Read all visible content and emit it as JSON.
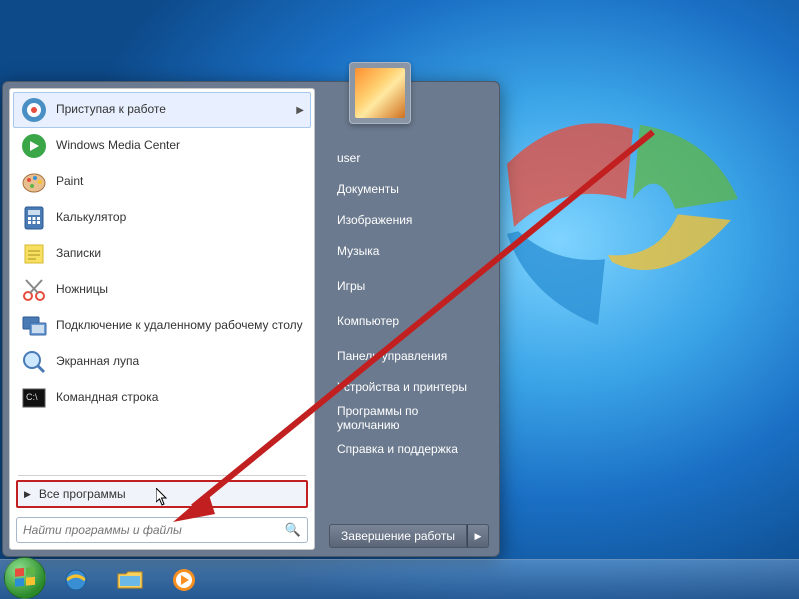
{
  "programs": [
    {
      "label": "Приступая к работе",
      "hasSub": true,
      "icon": "getting-started"
    },
    {
      "label": "Windows Media Center",
      "hasSub": false,
      "icon": "wmc"
    },
    {
      "label": "Paint",
      "hasSub": false,
      "icon": "paint"
    },
    {
      "label": "Калькулятор",
      "hasSub": false,
      "icon": "calc"
    },
    {
      "label": "Записки",
      "hasSub": false,
      "icon": "notes"
    },
    {
      "label": "Ножницы",
      "hasSub": false,
      "icon": "snip"
    },
    {
      "label": "Подключение к удаленному рабочему столу",
      "hasSub": false,
      "icon": "rdp"
    },
    {
      "label": "Экранная лупа",
      "hasSub": false,
      "icon": "magnifier"
    },
    {
      "label": "Командная строка",
      "hasSub": false,
      "icon": "cmd"
    }
  ],
  "allPrograms": "Все программы",
  "search": {
    "placeholder": "Найти программы и файлы"
  },
  "user": "user",
  "rightItems": [
    "Документы",
    "Изображения",
    "Музыка",
    "",
    "Игры",
    "",
    "Компьютер",
    "",
    "Панель управления",
    "Устройства и принтеры",
    "Программы по умолчанию",
    "Справка и поддержка"
  ],
  "shutdown": "Завершение работы"
}
